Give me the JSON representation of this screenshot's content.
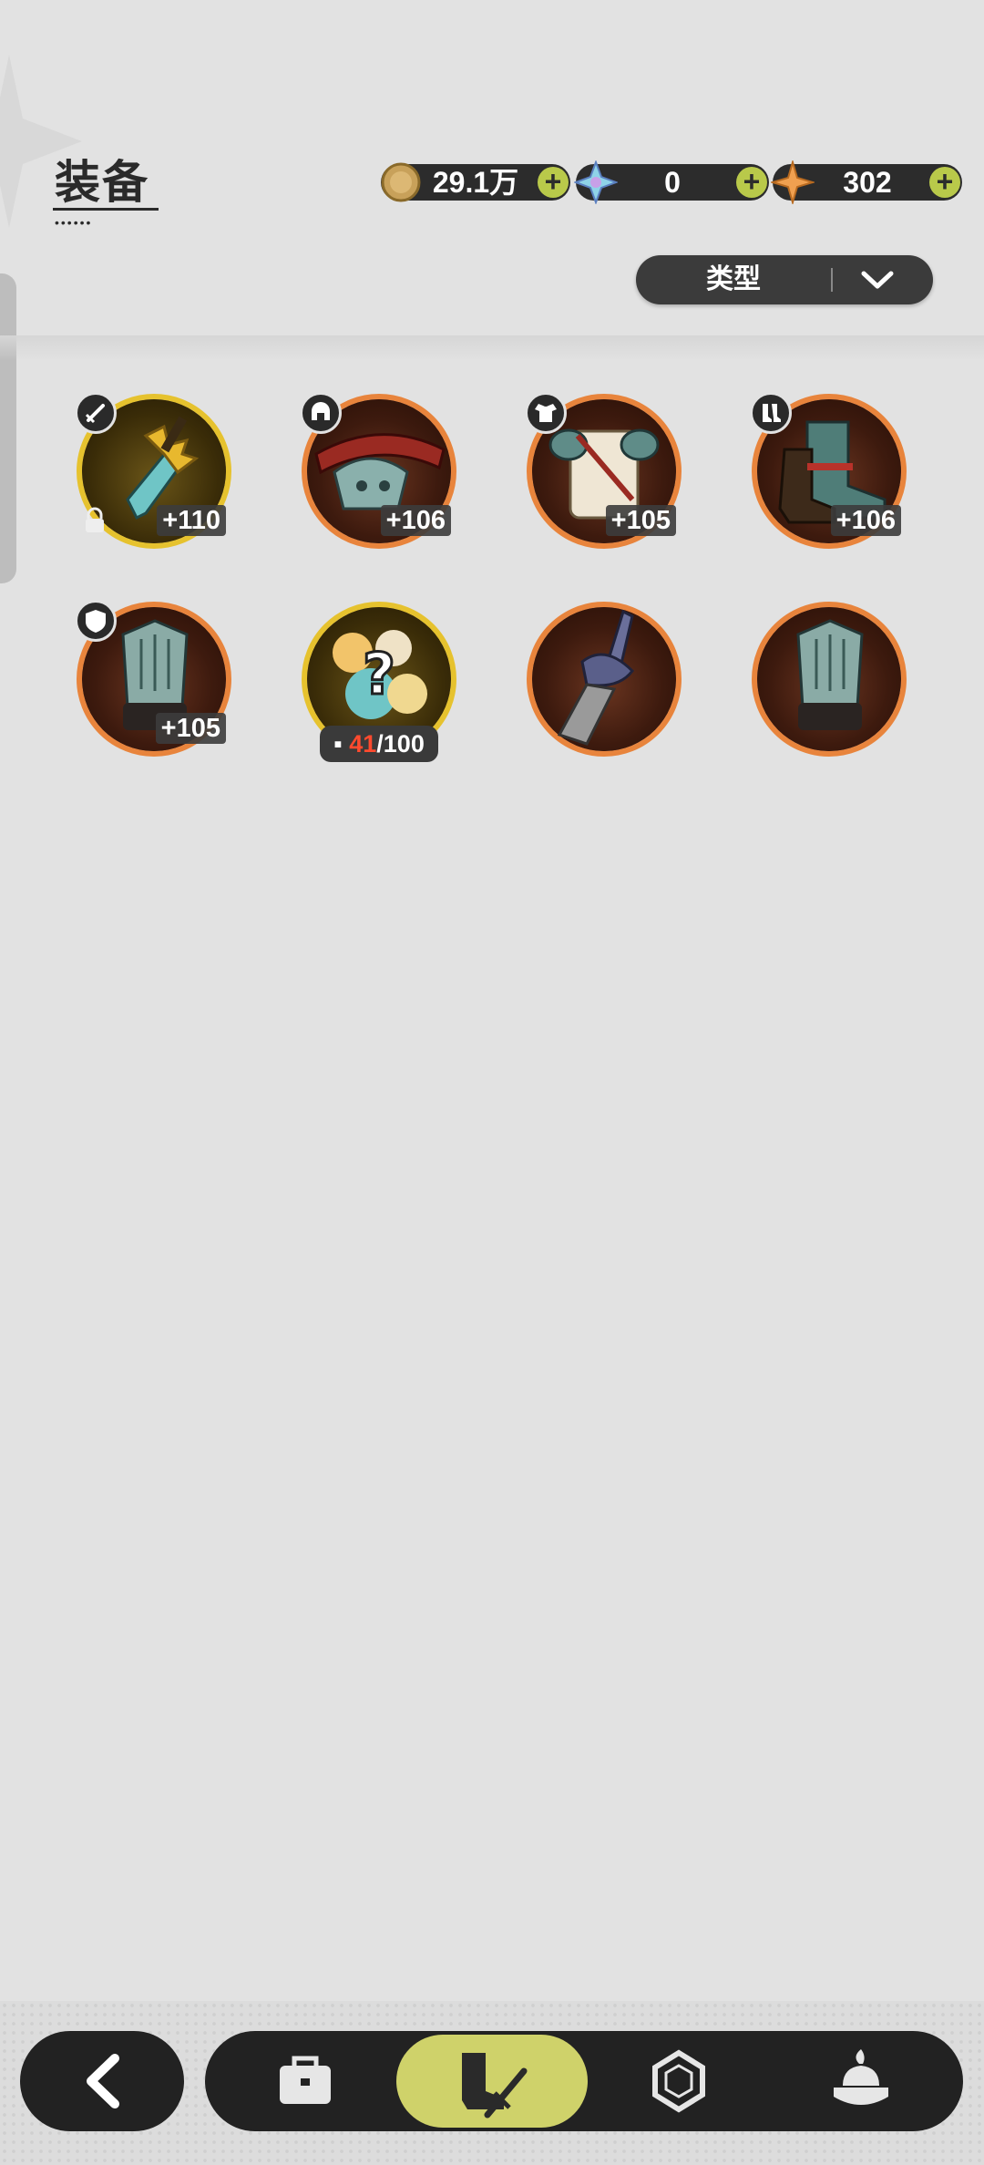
{
  "header": {
    "title": "装备"
  },
  "currencies": [
    {
      "icon": "gold-coin-icon",
      "value": "29.1万",
      "color": "#c8a15a"
    },
    {
      "icon": "crystal-star-icon",
      "value": "0",
      "color": "#8fd3e8"
    },
    {
      "icon": "orange-star-icon",
      "value": "302",
      "color": "#f0a050"
    }
  ],
  "filter": {
    "label": "类型"
  },
  "items": [
    {
      "slot_icon": "sword-slot-icon",
      "art": "golden-sword-icon",
      "level": "+110",
      "locked": true,
      "rarity": "gold"
    },
    {
      "slot_icon": "helmet-slot-icon",
      "art": "helmet-icon",
      "level": "+106",
      "rarity": "orange"
    },
    {
      "slot_icon": "armor-slot-icon",
      "art": "armor-icon",
      "level": "+105",
      "rarity": "orange"
    },
    {
      "slot_icon": "boots-slot-icon",
      "art": "boots-icon",
      "level": "+106",
      "rarity": "orange"
    },
    {
      "slot_icon": "shield-slot-icon",
      "art": "gauntlet-icon",
      "level": "+105",
      "rarity": "orange"
    },
    {
      "art": "mystery-fragment-icon",
      "fragments_current": "41",
      "fragments_total": "/100",
      "rarity": "gold"
    },
    {
      "art": "spear-tip-icon",
      "rarity": "orange"
    },
    {
      "art": "gauntlet-icon",
      "rarity": "orange"
    }
  ],
  "bottom_nav": {
    "back": "back-arrow-icon",
    "tabs": [
      {
        "icon": "bag-icon",
        "active": false
      },
      {
        "icon": "equipment-icon",
        "active": true
      },
      {
        "icon": "gem-icon",
        "active": false
      },
      {
        "icon": "dessert-icon",
        "active": false
      }
    ],
    "active_color": "#cfd26a"
  }
}
